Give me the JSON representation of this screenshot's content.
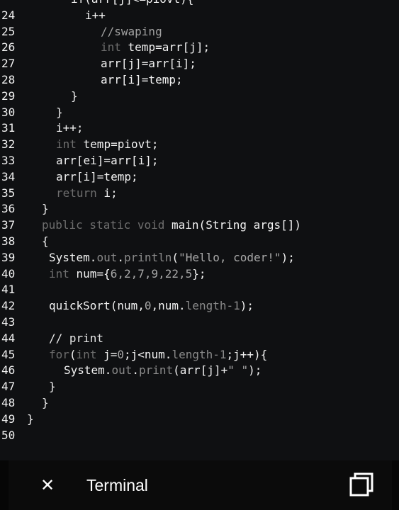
{
  "editor": {
    "line_numbers": [
      "24",
      "25",
      "26",
      "27",
      "28",
      "29",
      "30",
      "31",
      "32",
      "33",
      "34",
      "35",
      "36",
      "37",
      "38",
      "39",
      "40",
      "41",
      "42",
      "43",
      "44",
      "45",
      "46",
      "47",
      "48",
      "49",
      "50"
    ],
    "top_partial_line": "if(arr[j]<=piovt){",
    "code": {
      "l24": "i++",
      "l25": "//swaping",
      "l26_kw": "int",
      "l26_rest": " temp=arr[j];",
      "l27": "arr[j]=arr[i];",
      "l28": "arr[i]=temp;",
      "l29": "}",
      "l30": "}",
      "l31": "i++;",
      "l32_kw": "int",
      "l32_rest": " temp=piovt;",
      "l33": "arr[ei]=arr[i];",
      "l34": "arr[i]=temp;",
      "l35_kw": "return",
      "l35_rest": " i;",
      "l36": "}",
      "l37_kw": "public static void",
      "l37_rest": " main(String args[])",
      "l38": "{",
      "l39_a": "System.",
      "l39_b": "out",
      "l39_c": ".",
      "l39_d": "println",
      "l39_e": "(",
      "l39_f": "\"Hello, coder!\"",
      "l39_g": ");",
      "l40_kw": "int",
      "l40_a": " num={",
      "l40_nums": "6,2,7,9,22,5",
      "l40_b": "};",
      "l42_a": "quickSort(num,",
      "l42_zero": "0",
      "l42_b": ",num.",
      "l42_len": "length-1",
      "l42_c": ");",
      "l44": "// print",
      "l45_kw": "for",
      "l45_a": "(",
      "l45_int": "int",
      "l45_b": " j=",
      "l45_zero": "0",
      "l45_c": ";j<num.",
      "l45_len": "length-1",
      "l45_d": ";j++){",
      "l46_a": "System.",
      "l46_b": "out",
      "l46_c": ".",
      "l46_d": "print",
      "l46_e": "(arr[j]+",
      "l46_str": "\" \"",
      "l46_f": ");",
      "l47": "}",
      "l48": "}",
      "l49": "}"
    }
  },
  "bottom_bar": {
    "close_icon": "close-icon",
    "title": "Terminal",
    "window_icon": "window-icon"
  }
}
